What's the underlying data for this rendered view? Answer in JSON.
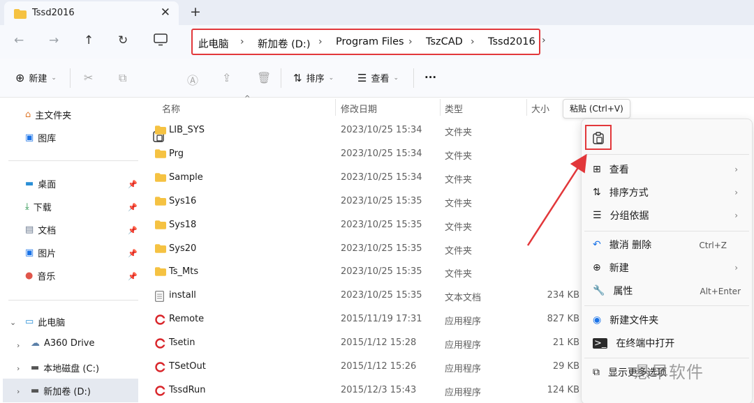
{
  "tab": {
    "title": "Tssd2016",
    "close": "✕",
    "new_tab": "+"
  },
  "address_bar": {
    "crumbs": [
      "此电脑",
      "新加卷 (D:)",
      "Program Files",
      "TszCAD",
      "Tssd2016"
    ],
    "separator": "›"
  },
  "commands": {
    "new_label": "新建",
    "sort_label": "排序",
    "view_label": "查看",
    "more": "···"
  },
  "sidebar": {
    "home": "主文件夹",
    "gallery": "图库",
    "quick": [
      "桌面",
      "下载",
      "文档",
      "图片",
      "音乐"
    ],
    "this_pc": "此电脑",
    "drives": [
      "A360 Drive",
      "本地磁盘 (C:)",
      "新加卷 (D:)"
    ]
  },
  "columns": {
    "name": "名称",
    "date": "修改日期",
    "type": "类型",
    "size": "大小"
  },
  "files": [
    {
      "name": "LIB_SYS",
      "date": "2023/10/25 15:34",
      "type": "文件夹",
      "size": ""
    },
    {
      "name": "Prg",
      "date": "2023/10/25 15:34",
      "type": "文件夹",
      "size": ""
    },
    {
      "name": "Sample",
      "date": "2023/10/25 15:34",
      "type": "文件夹",
      "size": ""
    },
    {
      "name": "Sys16",
      "date": "2023/10/25 15:35",
      "type": "文件夹",
      "size": ""
    },
    {
      "name": "Sys18",
      "date": "2023/10/25 15:35",
      "type": "文件夹",
      "size": ""
    },
    {
      "name": "Sys20",
      "date": "2023/10/25 15:35",
      "type": "文件夹",
      "size": ""
    },
    {
      "name": "Ts_Mts",
      "date": "2023/10/25 15:35",
      "type": "文件夹",
      "size": ""
    },
    {
      "name": "install",
      "date": "2023/10/25 15:35",
      "type": "文本文档",
      "size": "234 KB"
    },
    {
      "name": "Remote",
      "date": "2015/11/19 17:31",
      "type": "应用程序",
      "size": "827 KB"
    },
    {
      "name": "Tsetin",
      "date": "2015/1/12 15:28",
      "type": "应用程序",
      "size": "21 KB"
    },
    {
      "name": "TSetOut",
      "date": "2015/1/12 15:26",
      "type": "应用程序",
      "size": "29 KB"
    },
    {
      "name": "TssdRun",
      "date": "2015/12/3 15:43",
      "type": "应用程序",
      "size": "124 KB"
    }
  ],
  "tooltip": "粘贴 (Ctrl+V)",
  "context_menu": {
    "view": "查看",
    "sort": "排序方式",
    "group": "分组依据",
    "undo": "撤消 删除",
    "undo_shortcut": "Ctrl+Z",
    "new": "新建",
    "properties": "属性",
    "properties_shortcut": "Alt+Enter",
    "new_folder": "新建文件夹",
    "open_terminal": "在终端中打开",
    "show_more": "显示更多选项"
  },
  "watermark": "悬早软件",
  "colors": {
    "highlight": "#e2373a",
    "folder": "#f5c242",
    "accent": "#1a73e8"
  }
}
